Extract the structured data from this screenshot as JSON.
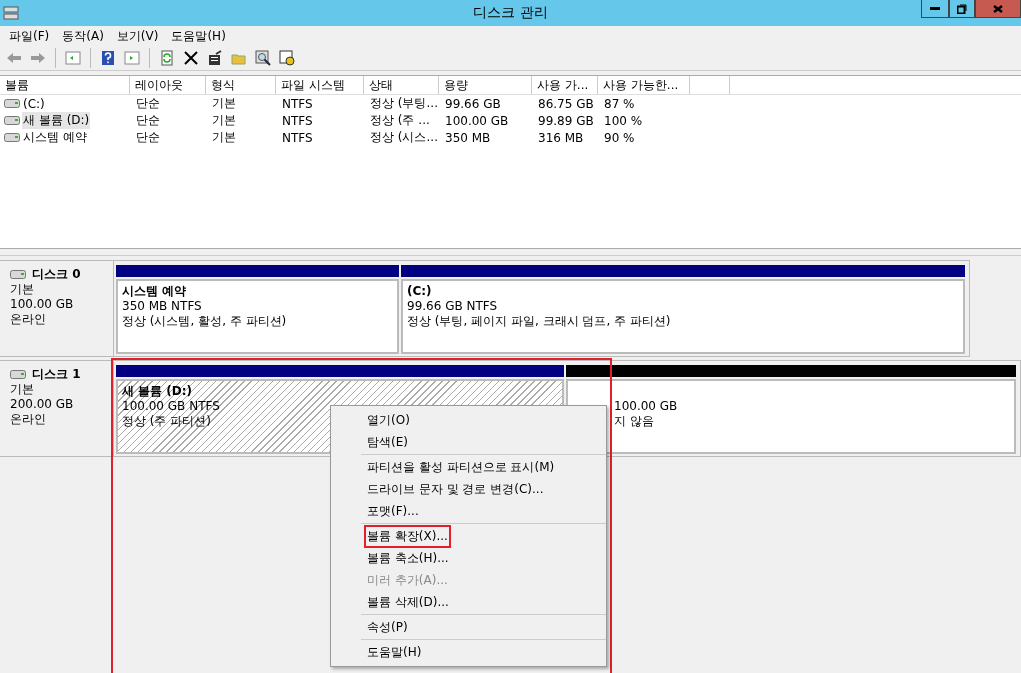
{
  "window": {
    "title": "디스크 관리"
  },
  "menu": [
    "파일(F)",
    "동작(A)",
    "보기(V)",
    "도움말(H)"
  ],
  "table": {
    "columns": [
      "볼륨",
      "레이아웃",
      "형식",
      "파일 시스템",
      "상태",
      "용량",
      "사용 가...",
      "사용 가능한..."
    ],
    "rows": [
      {
        "selected": false,
        "cells": [
          "(C:)",
          "단순",
          "기본",
          "NTFS",
          "정상 (부팅...",
          "99.66 GB",
          "86.75 GB",
          "87 %"
        ]
      },
      {
        "selected": true,
        "cells": [
          "새 볼륨 (D:)",
          "단순",
          "기본",
          "NTFS",
          "정상 (주 ...",
          "100.00 GB",
          "99.89 GB",
          "100 %"
        ]
      },
      {
        "selected": false,
        "cells": [
          "시스템 예약",
          "단순",
          "기본",
          "NTFS",
          "정상 (시스...",
          "350 MB",
          "316 MB",
          "90 %"
        ]
      }
    ]
  },
  "disks": [
    {
      "name": "디스크 0",
      "type": "기본",
      "size": "100.00 GB",
      "status": "온라인",
      "outlined": false,
      "partitions": [
        {
          "kind": "primary",
          "selected": false,
          "name": "시스템 예약",
          "size": "350 MB NTFS",
          "status": "정상 (시스템, 활성, 주 파티션)"
        },
        {
          "kind": "primary",
          "selected": false,
          "name": "(C:)",
          "size": "99.66 GB NTFS",
          "status": "정상 (부팅, 페이지 파일, 크래시 덤프, 주 파티션)"
        }
      ]
    },
    {
      "name": "디스크 1",
      "type": "기본",
      "size": "200.00 GB",
      "status": "온라인",
      "outlined": true,
      "partitions": [
        {
          "kind": "primary",
          "selected": true,
          "name": "새 볼륨  (D:)",
          "size": "100.00 GB NTFS",
          "status": "정상 (주 파티션)"
        },
        {
          "kind": "unallocated",
          "selected": false,
          "size": "100.00 GB",
          "status": "지 않음"
        }
      ]
    }
  ],
  "context_menu": {
    "groups": [
      [
        {
          "label": "열기(O)",
          "disabled": false,
          "outlined": false
        },
        {
          "label": "탐색(E)",
          "disabled": false,
          "outlined": false
        }
      ],
      [
        {
          "label": "파티션을 활성 파티션으로 표시(M)",
          "disabled": false,
          "outlined": false
        },
        {
          "label": "드라이브 문자 및 경로 변경(C)...",
          "disabled": false,
          "outlined": false
        },
        {
          "label": "포맷(F)...",
          "disabled": false,
          "outlined": false
        }
      ],
      [
        {
          "label": "볼륨 확장(X)...",
          "disabled": false,
          "outlined": true
        },
        {
          "label": "볼륨 축소(H)...",
          "disabled": false,
          "outlined": false
        },
        {
          "label": "미러 추가(A)...",
          "disabled": true,
          "outlined": false
        },
        {
          "label": "볼륨 삭제(D)...",
          "disabled": false,
          "outlined": false
        }
      ],
      [
        {
          "label": "속성(P)",
          "disabled": false,
          "outlined": false
        }
      ],
      [
        {
          "label": "도움말(H)",
          "disabled": false,
          "outlined": false
        }
      ]
    ]
  }
}
